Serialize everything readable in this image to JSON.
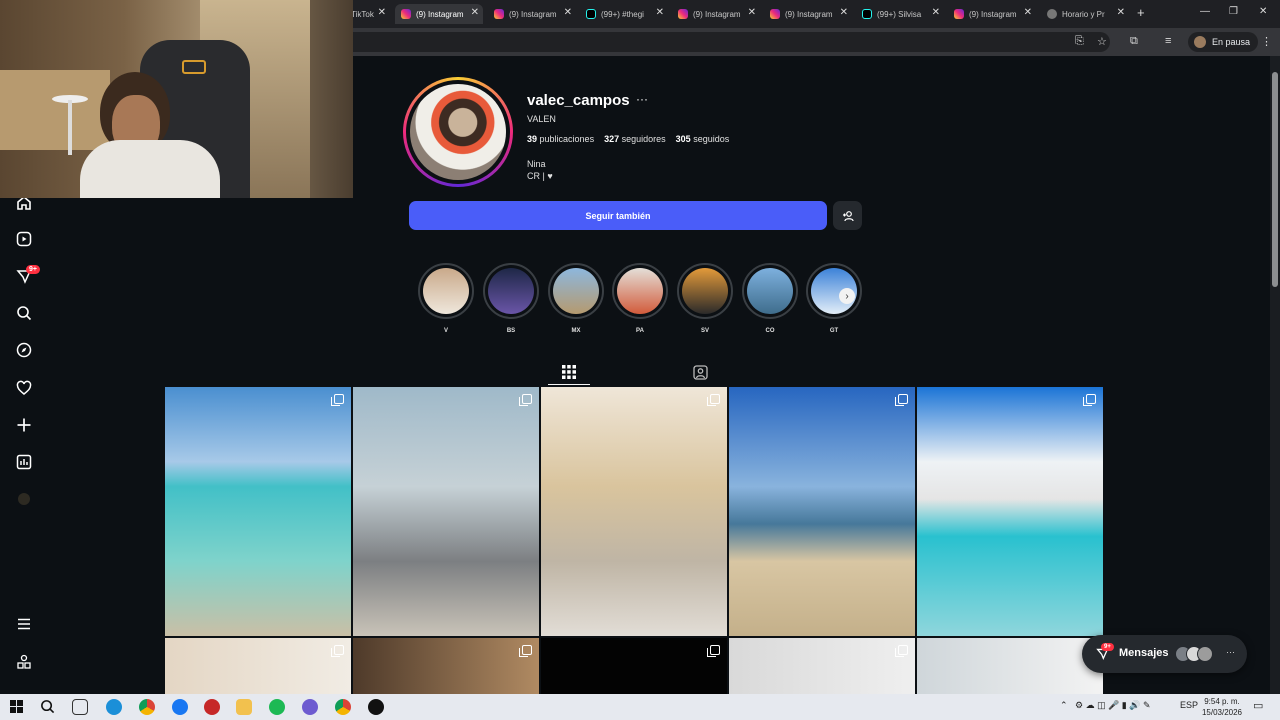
{
  "browser": {
    "tabs": [
      {
        "label": "TikTok",
        "icon": "tiktok-icon"
      },
      {
        "label": "(9) Instagram",
        "icon": "instagram-icon",
        "active": true
      },
      {
        "label": "(9) Instagram",
        "icon": "instagram-icon"
      },
      {
        "label": "(99+) #thegi",
        "icon": "tiktok-icon"
      },
      {
        "label": "(9) Instagram",
        "icon": "instagram-icon"
      },
      {
        "label": "(9) Instagram",
        "icon": "instagram-icon"
      },
      {
        "label": "(99+) Silvisa",
        "icon": "tiktok-icon"
      },
      {
        "label": "(9) Instagram",
        "icon": "instagram-icon"
      },
      {
        "label": "Horario y Pr",
        "icon": "globe-icon"
      }
    ],
    "close_glyph": "✕",
    "new_tab": "+",
    "profile_label": "En pausa"
  },
  "nav": {
    "notifications_badge": "9+"
  },
  "profile": {
    "username": "valec_campos",
    "options": "···",
    "full_name": "VALEN",
    "posts_count": "39",
    "posts_label": "publicaciones",
    "followers_count": "327",
    "followers_label": "seguidores",
    "following_count": "305",
    "following_label": "seguidos",
    "bio_line1": "Nina",
    "bio_line2": "CR | ♥"
  },
  "actions": {
    "follow_label": "Seguir también"
  },
  "highlights": [
    {
      "label": "V",
      "colors": [
        "#c9a98a",
        "#efe7dc"
      ]
    },
    {
      "label": "BS",
      "colors": [
        "#1e2747",
        "#6a55a8"
      ]
    },
    {
      "label": "MX",
      "colors": [
        "#8db7dd",
        "#b59a6f"
      ]
    },
    {
      "label": "PA",
      "colors": [
        "#e4dfd8",
        "#d25b3b"
      ]
    },
    {
      "label": "SV",
      "colors": [
        "#e39a3a",
        "#2b2a2a"
      ]
    },
    {
      "label": "CO",
      "colors": [
        "#7db0de",
        "#3f6d8c"
      ]
    },
    {
      "label": "GT",
      "colors": [
        "#3c82d8",
        "#e3eef8"
      ]
    }
  ],
  "grid": [
    {
      "bg": "linear-gradient(180deg,#4a8fd0 0%,#a7c9e8 30%,#42c0c7 40%,#7fd3cb 70%,#c9bfa6 100%)"
    },
    {
      "bg": "linear-gradient(180deg,#9fb9c9 0%,#c6d1d6 40%,#7c7f82 70%,#c9c3b8 100%)"
    },
    {
      "bg": "linear-gradient(180deg,#efe6d8 0%,#d9c49d 40%,#bfb5a5 70%,#e2ddd6 100%)"
    },
    {
      "bg": "linear-gradient(180deg,#2766c0 0%,#89b3dd 40%,#46789a 55%,#d8c6a3 70%,#c4b08a 100%)"
    },
    {
      "bg": "linear-gradient(180deg,#1b74d6 0%,#eef2f5 30%,#e5e5e5 45%,#29c1cf 60%,#8fd6dc 100%)"
    },
    {
      "bg": "linear-gradient(90deg,#e4d6c4,#f1ece4)"
    },
    {
      "bg": "linear-gradient(90deg,#4e3a2a,#b08a62)"
    },
    {
      "bg": "#030303"
    },
    {
      "bg": "linear-gradient(90deg,#d9d9d9,#efefef)"
    },
    {
      "bg": "linear-gradient(90deg,#cfd6da,#f3f3f3)"
    }
  ],
  "messages": {
    "label": "Mensajes",
    "badge": "9+",
    "more": "···"
  },
  "taskbar": {
    "language": "ESP",
    "time": "9:54 p. m.",
    "date": "15/03/2026"
  }
}
